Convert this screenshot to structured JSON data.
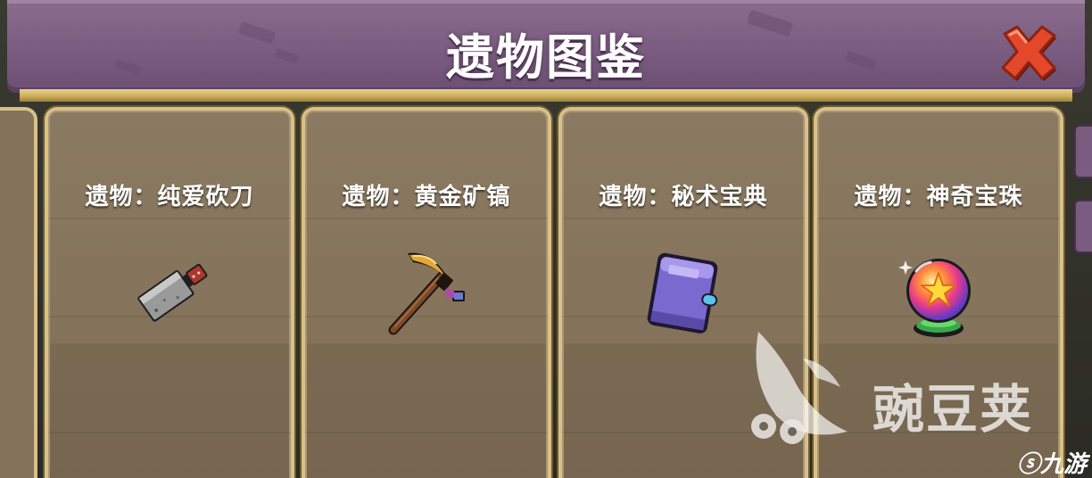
{
  "title": "遗物图鉴",
  "close_button": {
    "icon": "close-x-icon",
    "color": "#e5472a"
  },
  "cards": [
    {
      "label": "遗物：纯爱砍刀",
      "icon": "cleaver-icon"
    },
    {
      "label": "遗物：黄金矿镐",
      "icon": "golden-pickaxe-icon"
    },
    {
      "label": "遗物：秘术宝典",
      "icon": "spellbook-icon"
    },
    {
      "label": "遗物：神奇宝珠",
      "icon": "rainbow-orb-icon"
    }
  ],
  "watermarks": {
    "wandoujia": "豌豆荚",
    "nine_you": "九游"
  },
  "colors": {
    "title_bar": "#7a5c80",
    "card_bg": "#84725a",
    "card_border": "#d8c08a"
  }
}
